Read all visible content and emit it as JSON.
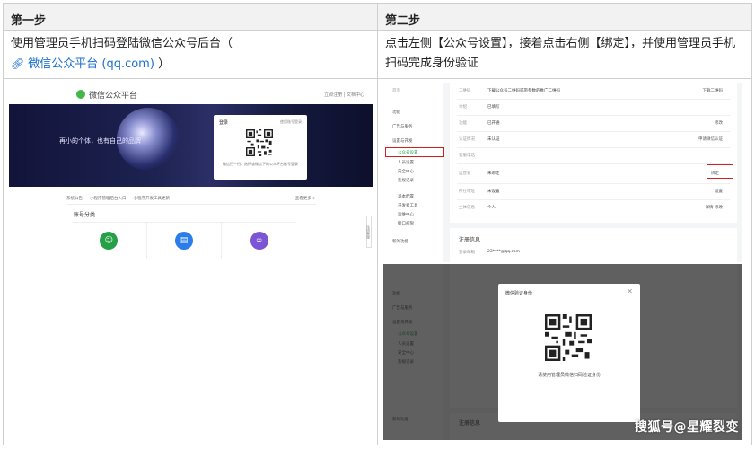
{
  "headers": {
    "step1": "第一步",
    "step2": "第二步"
  },
  "step1": {
    "text": "使用管理员手机扫码登陆微信公众号后台（",
    "link_text": "微信公众平台 (qq.com)",
    "text_end": "）",
    "link_icon": "link-icon"
  },
  "step2": {
    "text": "点击左侧【公众号设置】，接着点击右侧【绑定】，并使用管理员手机扫码完成身份验证"
  },
  "shot1": {
    "brand": "微信公众平台",
    "toplinks": "立即注册 | 文档中心",
    "slogan": "再小的个体，也有自己的品牌",
    "login_title": "登录",
    "login_alt": "使用账号登录",
    "login_tip": "微信扫一扫，选择该微信下的公众平台账号登录",
    "notices": [
      "系统公告",
      "小程序管理后台入口",
      "小程序开发工具更新"
    ],
    "more": "查看更多 >",
    "category_title": "账号分类",
    "side_button": "在线客服",
    "icons": [
      "service-account-icon",
      "subscription-icon",
      "miniprogram-icon"
    ],
    "colors": {
      "green": "#26a046",
      "blue": "#2b7de9",
      "purple": "#7b55d4"
    }
  },
  "shot2": {
    "nav": [
      "首页",
      "功能",
      "广告与服务",
      "设置与开发",
      "公众号设置",
      "人员设置",
      "安全中心",
      "违规记录",
      "基本配置",
      "开发者工具",
      "运维中心",
      "接口权限",
      "新的功能"
    ],
    "rows": [
      {
        "label": "二维码",
        "value": "下载公众号二维码或带参数的推广二维码",
        "action": "下载二维码"
      },
      {
        "label": "介绍",
        "value": "已填写",
        "action": ""
      },
      {
        "label": "功能",
        "value": "已开通",
        "action": "修改"
      },
      {
        "label": "认证情况",
        "value": "未认证",
        "action": "申请微信认证"
      },
      {
        "label": "客服电话",
        "value": "",
        "action": ""
      },
      {
        "label": "运营者",
        "value": "未绑定",
        "action": "绑定"
      },
      {
        "label": "所在地址",
        "value": "未设置",
        "action": "设置"
      },
      {
        "label": "主体信息",
        "value": "个人",
        "action": "详情 修改"
      }
    ],
    "reg_title": "注册信息",
    "reg_email_label": "登录邮箱",
    "reg_email_value": "23****@qq.com",
    "modal_title": "微信验证身份",
    "modal_tip": "请使用管理员微信扫码验证身份"
  },
  "watermark": "搜狐号@星耀裂变"
}
